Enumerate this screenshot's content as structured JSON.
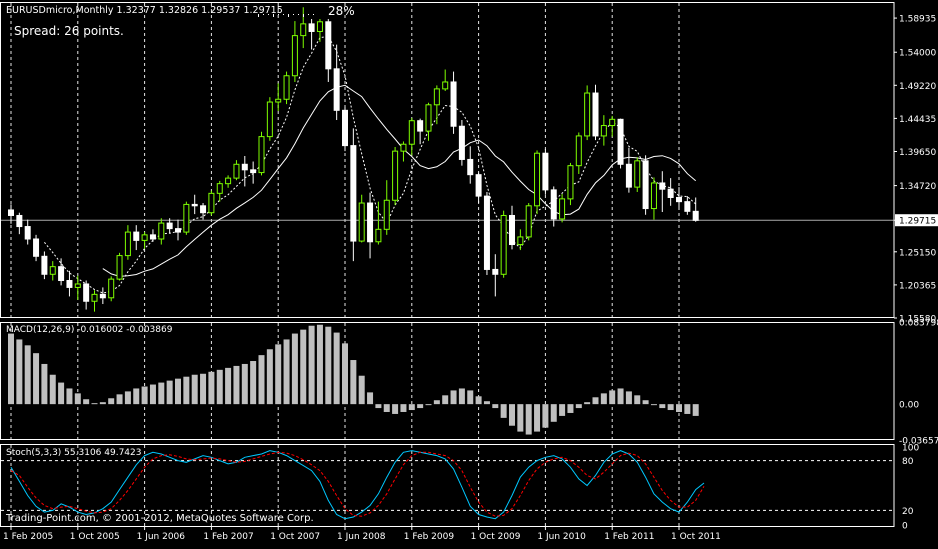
{
  "header": {
    "symbol_line": "EURUSDmicro,Monthly  1.32377 1.32826 1.29537 1.29715",
    "progress_pct": "28%",
    "spread_text": "Spread: 26 points."
  },
  "panels": {
    "macd": {
      "label": "MACD(12,26,9) -0.016002 -0.003869"
    },
    "stoch": {
      "label": "Stoch(5,3,3) 55.3106 49.7423"
    }
  },
  "watermark": "Trading-Point.com, © 2001-2012, MetaQuotes Software Corp.",
  "colors": {
    "background": "#000000",
    "grid": "#ffffff",
    "bull": "#7fff00",
    "bear": "#ffffff",
    "ma_fast": "#ffffff",
    "ma_slow": "#ffffff",
    "macd_hist": "#c0c0c0",
    "macd_signal": "#ff0000",
    "stoch_main": "#00c8ff",
    "stoch_signal": "#ff0000",
    "text": "#ffffff"
  },
  "chart_data": [
    {
      "type": "candlestick",
      "title": "EURUSDmicro,Monthly",
      "y_ticks": [
        "1.58935",
        "1.54000",
        "1.49220",
        "1.44435",
        "1.39650",
        "1.34720",
        "1.29715",
        "1.25150",
        "1.20365",
        "1.15580"
      ],
      "y_range": [
        1.1558,
        1.6126
      ],
      "current_price": 1.29715,
      "x_ticks": [
        {
          "i": 0,
          "label": "1 Feb 2005"
        },
        {
          "i": 8,
          "label": "1 Oct 2005"
        },
        {
          "i": 16,
          "label": "1 Jun 2006"
        },
        {
          "i": 24,
          "label": "1 Feb 2007"
        },
        {
          "i": 32,
          "label": "1 Oct 2007"
        },
        {
          "i": 40,
          "label": "1 Jun 2008"
        },
        {
          "i": 48,
          "label": "1 Feb 2009"
        },
        {
          "i": 56,
          "label": "1 Oct 2009"
        },
        {
          "i": 64,
          "label": "1 Jun 2010"
        },
        {
          "i": 72,
          "label": "1 Feb 2011"
        },
        {
          "i": 80,
          "label": "1 Oct 2011"
        }
      ],
      "series_ohlc": [
        [
          1.312,
          1.32,
          1.292,
          1.304
        ],
        [
          1.304,
          1.308,
          1.277,
          1.288
        ],
        [
          1.288,
          1.298,
          1.262,
          1.27
        ],
        [
          1.27,
          1.276,
          1.238,
          1.245
        ],
        [
          1.245,
          1.252,
          1.212,
          1.219
        ],
        [
          1.219,
          1.238,
          1.21,
          1.23
        ],
        [
          1.23,
          1.242,
          1.203,
          1.21
        ],
        [
          1.21,
          1.224,
          1.187,
          1.2
        ],
        [
          1.2,
          1.217,
          1.182,
          1.205
        ],
        [
          1.205,
          1.21,
          1.168,
          1.18
        ],
        [
          1.18,
          1.196,
          1.165,
          1.19
        ],
        [
          1.19,
          1.2,
          1.176,
          1.185
        ],
        [
          1.185,
          1.216,
          1.18,
          1.212
        ],
        [
          1.212,
          1.25,
          1.21,
          1.246
        ],
        [
          1.246,
          1.29,
          1.24,
          1.28
        ],
        [
          1.28,
          1.29,
          1.254,
          1.268
        ],
        [
          1.268,
          1.28,
          1.256,
          1.276
        ],
        [
          1.276,
          1.284,
          1.266,
          1.27
        ],
        [
          1.27,
          1.3,
          1.262,
          1.293
        ],
        [
          1.293,
          1.3,
          1.278,
          1.285
        ],
        [
          1.285,
          1.298,
          1.268,
          1.28
        ],
        [
          1.28,
          1.324,
          1.276,
          1.32
        ],
        [
          1.32,
          1.334,
          1.306,
          1.318
        ],
        [
          1.318,
          1.322,
          1.298,
          1.308
        ],
        [
          1.308,
          1.34,
          1.304,
          1.336
        ],
        [
          1.336,
          1.354,
          1.324,
          1.35
        ],
        [
          1.35,
          1.362,
          1.344,
          1.358
        ],
        [
          1.358,
          1.384,
          1.355,
          1.378
        ],
        [
          1.378,
          1.39,
          1.346,
          1.37
        ],
        [
          1.37,
          1.382,
          1.35,
          1.366
        ],
        [
          1.366,
          1.425,
          1.362,
          1.418
        ],
        [
          1.418,
          1.475,
          1.412,
          1.468
        ],
        [
          1.468,
          1.495,
          1.455,
          1.472
        ],
        [
          1.472,
          1.512,
          1.465,
          1.506
        ],
        [
          1.506,
          1.585,
          1.497,
          1.564
        ],
        [
          1.564,
          1.605,
          1.546,
          1.581
        ],
        [
          1.581,
          1.588,
          1.544,
          1.57
        ],
        [
          1.57,
          1.588,
          1.555,
          1.584
        ],
        [
          1.584,
          1.588,
          1.497,
          1.516
        ],
        [
          1.516,
          1.551,
          1.442,
          1.456
        ],
        [
          1.456,
          1.461,
          1.397,
          1.405
        ],
        [
          1.405,
          1.43,
          1.238,
          1.267
        ],
        [
          1.267,
          1.334,
          1.265,
          1.322
        ],
        [
          1.322,
          1.337,
          1.242,
          1.266
        ],
        [
          1.266,
          1.324,
          1.262,
          1.284
        ],
        [
          1.284,
          1.355,
          1.276,
          1.326
        ],
        [
          1.326,
          1.403,
          1.319,
          1.397
        ],
        [
          1.397,
          1.411,
          1.382,
          1.407
        ],
        [
          1.407,
          1.445,
          1.391,
          1.441
        ],
        [
          1.441,
          1.444,
          1.407,
          1.426
        ],
        [
          1.426,
          1.467,
          1.412,
          1.464
        ],
        [
          1.464,
          1.492,
          1.436,
          1.487
        ],
        [
          1.487,
          1.515,
          1.484,
          1.497
        ],
        [
          1.497,
          1.512,
          1.422,
          1.433
        ],
        [
          1.433,
          1.442,
          1.376,
          1.385
        ],
        [
          1.385,
          1.404,
          1.35,
          1.363
        ],
        [
          1.363,
          1.366,
          1.322,
          1.332
        ],
        [
          1.332,
          1.338,
          1.218,
          1.226
        ],
        [
          1.226,
          1.248,
          1.187,
          1.219
        ],
        [
          1.219,
          1.311,
          1.214,
          1.304
        ],
        [
          1.304,
          1.318,
          1.255,
          1.262
        ],
        [
          1.262,
          1.284,
          1.254,
          1.273
        ],
        [
          1.273,
          1.322,
          1.268,
          1.318
        ],
        [
          1.318,
          1.398,
          1.306,
          1.394
        ],
        [
          1.394,
          1.4,
          1.334,
          1.341
        ],
        [
          1.341,
          1.346,
          1.288,
          1.299
        ],
        [
          1.299,
          1.335,
          1.294,
          1.328
        ],
        [
          1.328,
          1.38,
          1.319,
          1.376
        ],
        [
          1.376,
          1.424,
          1.364,
          1.419
        ],
        [
          1.419,
          1.492,
          1.413,
          1.481
        ],
        [
          1.481,
          1.493,
          1.413,
          1.419
        ],
        [
          1.419,
          1.449,
          1.405,
          1.434
        ],
        [
          1.434,
          1.448,
          1.418,
          1.443
        ],
        [
          1.443,
          1.444,
          1.372,
          1.378
        ],
        [
          1.378,
          1.402,
          1.337,
          1.345
        ],
        [
          1.345,
          1.388,
          1.338,
          1.383
        ],
        [
          1.383,
          1.391,
          1.305,
          1.314
        ],
        [
          1.314,
          1.359,
          1.298,
          1.351
        ],
        [
          1.351,
          1.368,
          1.309,
          1.342
        ],
        [
          1.342,
          1.358,
          1.318,
          1.33
        ],
        [
          1.33,
          1.345,
          1.312,
          1.324
        ],
        [
          1.324,
          1.332,
          1.305,
          1.31
        ],
        [
          1.31,
          1.33,
          1.295,
          1.297
        ]
      ],
      "ma_fast_period_note": "",
      "ma_slow_period_note": ""
    },
    {
      "type": "bar",
      "title": "MACD(12,26,9) -0.016002 -0.003869",
      "y_ticks": [
        "0.083798",
        "0.00",
        "-0.036573"
      ],
      "y_range": [
        -0.036573,
        0.083798
      ],
      "values": [
        0.072,
        0.066,
        0.06,
        0.052,
        0.041,
        0.03,
        0.022,
        0.016,
        0.011,
        0.005,
        0.001,
        0.002,
        0.006,
        0.01,
        0.013,
        0.016,
        0.018,
        0.02,
        0.022,
        0.024,
        0.026,
        0.028,
        0.03,
        0.031,
        0.033,
        0.035,
        0.037,
        0.039,
        0.041,
        0.044,
        0.05,
        0.056,
        0.061,
        0.066,
        0.072,
        0.076,
        0.08,
        0.081,
        0.079,
        0.073,
        0.062,
        0.045,
        0.029,
        0.012,
        -0.004,
        -0.008,
        -0.01,
        -0.008,
        -0.006,
        -0.004,
        -0.001,
        0.004,
        0.009,
        0.014,
        0.016,
        0.014,
        0.008,
        0.003,
        -0.004,
        -0.014,
        -0.022,
        -0.028,
        -0.031,
        -0.028,
        -0.024,
        -0.018,
        -0.012,
        -0.009,
        -0.004,
        0.002,
        0.007,
        0.011,
        0.014,
        0.016,
        0.013,
        0.009,
        0.004,
        0.0,
        -0.004,
        -0.006,
        -0.008,
        -0.01,
        -0.012
      ],
      "signal": [
        0.062,
        0.063,
        0.062,
        0.06,
        0.056,
        0.051,
        0.045,
        0.039,
        0.033,
        0.027,
        0.022,
        0.018,
        0.015,
        0.014,
        0.014,
        0.014,
        0.015,
        0.016,
        0.017,
        0.019,
        0.02,
        0.022,
        0.024,
        0.025,
        0.027,
        0.028,
        0.03,
        0.032,
        0.034,
        0.036,
        0.039,
        0.042,
        0.046,
        0.05,
        0.054,
        0.058,
        0.062,
        0.066,
        0.068,
        0.069,
        0.068,
        0.063,
        0.056,
        0.047,
        0.036,
        0.027,
        0.019,
        0.013,
        0.009,
        0.006,
        0.004,
        0.004,
        0.005,
        0.007,
        0.009,
        0.01,
        0.01,
        0.009,
        0.006,
        0.002,
        -0.003,
        -0.008,
        -0.013,
        -0.016,
        -0.018,
        -0.018,
        -0.017,
        -0.015,
        -0.013,
        -0.01,
        -0.006,
        -0.003,
        0.0,
        0.003,
        0.005,
        0.006,
        0.006,
        0.005,
        0.003,
        0.001,
        -0.001,
        -0.003,
        -0.004
      ]
    },
    {
      "type": "line",
      "title": "Stoch(5,3,3) 55.3106 49.7423",
      "y_ticks": [
        "100",
        "80",
        "20",
        "0"
      ],
      "y_range": [
        0,
        100
      ],
      "levels": [
        80,
        20
      ],
      "series": [
        {
          "values": [
            72,
            55,
            38,
            25,
            18,
            20,
            28,
            24,
            18,
            15,
            17,
            22,
            30,
            45,
            60,
            75,
            86,
            90,
            88,
            84,
            80,
            78,
            82,
            86,
            84,
            80,
            76,
            78,
            84,
            86,
            88,
            92,
            90,
            86,
            80,
            74,
            68,
            55,
            32,
            15,
            10,
            12,
            18,
            26,
            40,
            60,
            78,
            90,
            92,
            90,
            88,
            86,
            82,
            70,
            48,
            25,
            15,
            12,
            10,
            18,
            38,
            60,
            72,
            80,
            84,
            86,
            82,
            72,
            58,
            50,
            62,
            78,
            88,
            92,
            88,
            78,
            60,
            40,
            30,
            22,
            18,
            30,
            45,
            53
          ]
        },
        {
          "values": [
            68,
            62,
            48,
            35,
            26,
            22,
            24,
            25,
            22,
            19,
            17,
            18,
            22,
            32,
            44,
            58,
            72,
            82,
            86,
            87,
            85,
            82,
            81,
            82,
            83,
            82,
            80,
            78,
            79,
            82,
            85,
            88,
            90,
            89,
            86,
            81,
            75,
            68,
            55,
            38,
            22,
            14,
            13,
            17,
            26,
            40,
            58,
            75,
            86,
            90,
            90,
            88,
            86,
            80,
            68,
            48,
            30,
            18,
            13,
            14,
            22,
            38,
            56,
            70,
            78,
            82,
            84,
            80,
            72,
            62,
            58,
            66,
            76,
            86,
            89,
            86,
            76,
            60,
            44,
            32,
            24,
            24,
            32,
            49
          ]
        }
      ]
    }
  ]
}
